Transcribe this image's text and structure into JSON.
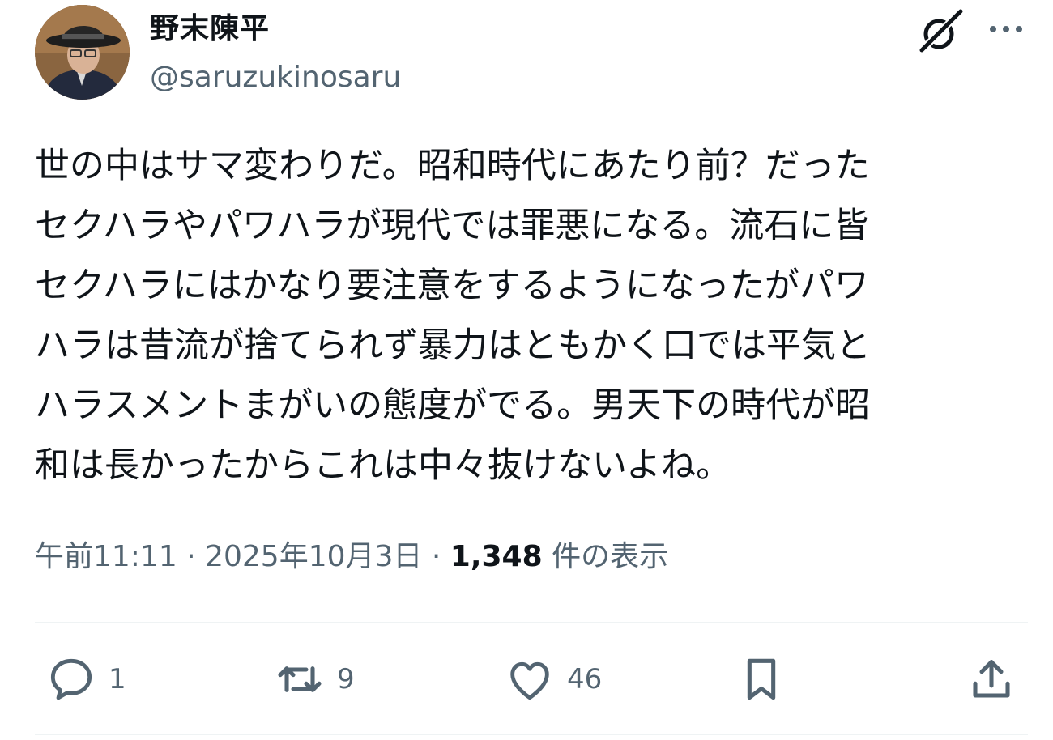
{
  "user": {
    "display_name": "野末陳平",
    "handle": "@saruzukinosaru"
  },
  "tweet": {
    "text": "世の中はサマ変わりだ。昭和時代にあたり前？だった\nセクハラやパワハラが現代では罪悪になる。流石に皆\nセクハラにはかなり要注意をするようになったがパワ\nハラは昔流が捨てられず暴力はともかく口では平気と\nハラスメントまがいの態度がでる。男天下の時代が昭\n和は長かったからこれは中々抜けないよね。"
  },
  "meta": {
    "time": "午前11:11",
    "separator": " · ",
    "date": "2025年10月3日",
    "views_count": "1,348",
    "views_label": "件の表示"
  },
  "actions": {
    "reply_count": "1",
    "retweet_count": "9",
    "like_count": "46"
  },
  "icons": {
    "header": [
      "grok-icon",
      "more-icon"
    ],
    "actions": [
      "reply-icon",
      "retweet-icon",
      "like-icon",
      "bookmark-icon",
      "share-icon"
    ]
  },
  "colors": {
    "text": "#0f1419",
    "secondary": "#536471",
    "divider": "#eff3f4",
    "background": "#ffffff"
  }
}
